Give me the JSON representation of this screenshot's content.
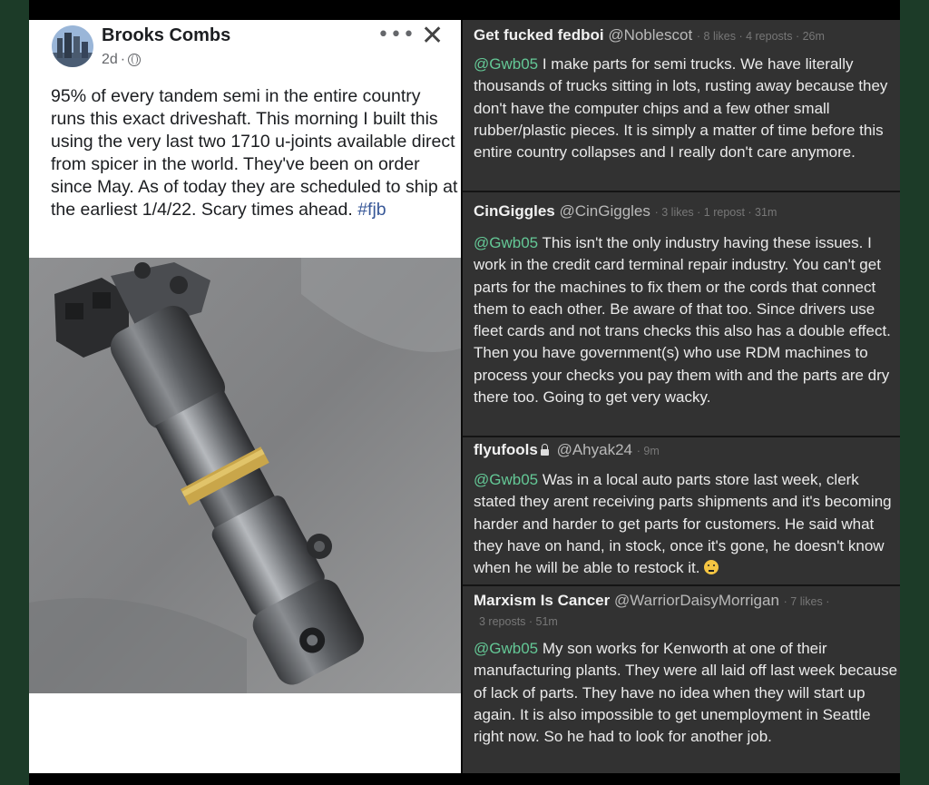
{
  "post": {
    "author": "Brooks Combs",
    "time": "2d",
    "more_icon": "ellipsis-icon",
    "close_icon": "close-icon",
    "text": "95% of every tandem semi in the entire country runs this exact driveshaft. This morning I built this using the very last two 1710 u-joints available direct from spicer in the world. They've been on order since May. As of today they are scheduled to ship at the earliest 1/4/22. Scary times ahead. ",
    "hashtag": "#fjb"
  },
  "comments": [
    {
      "name": "Get fucked fedboi",
      "handle": "@Noblescot",
      "meta": "· 8 likes · 4 reposts · 26m",
      "meta2": "",
      "mention": "@Gwb05",
      "text": " I make parts for semi trucks. We have literally thousands of trucks sitting in lots, rusting away because they don't have the computer chips and a few other small rubber/plastic pieces. It is simply a matter of time before this entire country collapses and I really don't care anymore."
    },
    {
      "name": "CinGiggles",
      "handle": "@CinGiggles",
      "meta": "· 3 likes · 1 repost · 31m",
      "meta2": "",
      "mention": "@Gwb05",
      "text": " This isn't the only industry having these issues. I work in the credit card terminal repair industry. You can't get parts for the machines to fix them or the cords that connect them to each other. Be aware of that too. Since drivers use fleet cards and not trans checks this also has a double effect. Then you have government(s) who use RDM machines to process your checks you pay them with and the parts are dry there too. Going to get very wacky."
    },
    {
      "name": "flyufools",
      "handle": "@Ahyak24",
      "meta": "· 9m",
      "meta2": "",
      "mention": "@Gwb05",
      "text": " Was in a local auto parts store last week, clerk stated they arent receiving parts shipments and it's becoming harder and harder to get parts for customers. He said what they have on hand, in stock, once it's gone, he doesn't know when he will be able to restock it. "
    },
    {
      "name": "Marxism Is Cancer",
      "handle": "@WarriorDaisyMorrigan",
      "meta": "· 7 likes ·",
      "meta2": "3 reposts · 51m",
      "mention": "@Gwb05",
      "text": " My son works for Kenworth at one of their manufacturing plants. They were all laid off last week because of lack of parts. They have no idea when they will start up again. It is also impossible to get unemployment in Seattle right now. So he had to look for another job."
    }
  ]
}
